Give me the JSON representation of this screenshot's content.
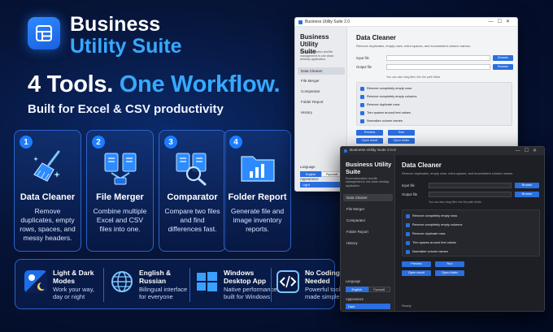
{
  "hero": {
    "brand_line1": "Business",
    "brand_line2": "Utility Suite",
    "headline_white": "4 Tools.",
    "headline_blue": "One Workflow.",
    "subline": "Built for Excel & CSV productivity"
  },
  "cards": [
    {
      "num": "1",
      "title": "Data Cleaner",
      "desc": "Remove duplicates, empty rows, spaces, and messy headers.",
      "icon": "broom-icon"
    },
    {
      "num": "2",
      "title": "File Merger",
      "desc": "Combine multiple Excel and CSV files into one.",
      "icon": "merge-files-icon"
    },
    {
      "num": "3",
      "title": "Comparator",
      "desc": "Compare two files and find differences fast.",
      "icon": "compare-magnifier-icon"
    },
    {
      "num": "4",
      "title": "Folder Report",
      "desc": "Generate file and image inventory reports.",
      "icon": "folder-chart-icon"
    }
  ],
  "features": [
    {
      "title1": "Light & Dark",
      "title2": "Modes",
      "desc1": "Work your way,",
      "desc2": "day or night",
      "icon": "theme-mode-icon"
    },
    {
      "title1": "English &",
      "title2": "Russian",
      "desc1": "Bilingual interface",
      "desc2": "for everyone",
      "icon": "globe-icon"
    },
    {
      "title1": "Windows",
      "title2": "Desktop App",
      "desc1": "Native performance,",
      "desc2": "built for Windows",
      "icon": "windows-logo-icon"
    },
    {
      "title1": "No Coding",
      "title2": "Needed",
      "desc1": "Powerful tools",
      "desc2": "made simple",
      "icon": "code-icon"
    }
  ],
  "light_window": {
    "title": "Business Utility Suite 2.0",
    "sidebar_title1": "Business Utility",
    "sidebar_title2": "Suite",
    "sidebar_desc": "Excel automation and file management in one clean desktop application.",
    "nav": [
      "Data Cleaner",
      "File Merger",
      "Comparator",
      "Folder Report",
      "History"
    ],
    "language_label": "Language",
    "lang_en": "English",
    "lang_ru": "Русский",
    "appearance_label": "Appearance",
    "appearance_value": "Light",
    "main_title": "Data Cleaner",
    "main_sub": "Remove duplicates, empty rows, extra spaces, and inconsistent column names.",
    "input_label": "Input file",
    "output_label": "Output file",
    "browse": "Browse",
    "hint": "You can also drag files into the path fields.",
    "options": [
      "Remove completely empty rows",
      "Remove completely empty columns",
      "Remove duplicate rows",
      "Trim spaces around text values",
      "Normalize column names"
    ],
    "preview": "Preview",
    "run": "Run",
    "open_result": "Open result",
    "open_folder": "Open folder"
  },
  "dark_window": {
    "title": "Business Utility Suite 2.0.0",
    "sidebar_title1": "Business Utility",
    "sidebar_title2": "Suite",
    "sidebar_desc": "Excel automation and file management in one clean desktop application.",
    "nav": [
      "Data Cleaner",
      "File Merger",
      "Comparator",
      "Folder Report",
      "History"
    ],
    "language_label": "Language",
    "lang_en": "English",
    "lang_ru": "Русский",
    "appearance_label": "Appearance",
    "appearance_value": "Dark",
    "main_title": "Data Cleaner",
    "main_sub": "Remove duplicates, empty rows, extra spaces, and inconsistent column names.",
    "input_label": "Input file",
    "output_label": "Output file",
    "browse": "Browse",
    "hint": "You can also drag files into the path fields.",
    "options": [
      "Remove completely empty rows",
      "Remove completely empty columns",
      "Remove duplicate rows",
      "Trim spaces around text values",
      "Normalize column names"
    ],
    "preview": "Preview",
    "run": "Run",
    "open_result": "Open result",
    "open_folder": "Open folder",
    "status": "Ready"
  },
  "colors": {
    "accent": "#38a8ff",
    "brand_blue": "#2b6fe0",
    "card_border": "#2c63c8"
  }
}
